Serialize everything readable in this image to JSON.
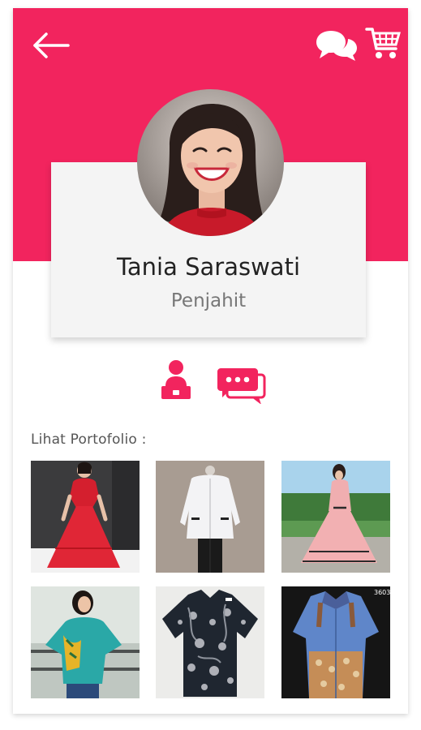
{
  "header": {
    "background_color": "#f2245e",
    "back_icon": "arrow-left-icon",
    "chat_icon": "chat-bubbles-icon",
    "cart_icon": "shopping-cart-icon"
  },
  "profile": {
    "name": "Tania Saraswati",
    "role": "Penjahit",
    "avatar": "profile-photo"
  },
  "actions": [
    {
      "icon": "tailor-icon",
      "label": ""
    },
    {
      "icon": "message-icon",
      "label": ""
    }
  ],
  "portfolio": {
    "label": "Lihat Portofolio :",
    "items": [
      {
        "name": "red-dress"
      },
      {
        "name": "white-jacket"
      },
      {
        "name": "pink-gown"
      },
      {
        "name": "teal-batik-blouse"
      },
      {
        "name": "black-batik-shirt"
      },
      {
        "name": "blue-batik-shirt",
        "tag": "3603"
      }
    ]
  },
  "colors": {
    "accent": "#f2245e",
    "card_bg": "#f4f4f4",
    "text_primary": "#222222",
    "text_secondary": "#777777"
  }
}
